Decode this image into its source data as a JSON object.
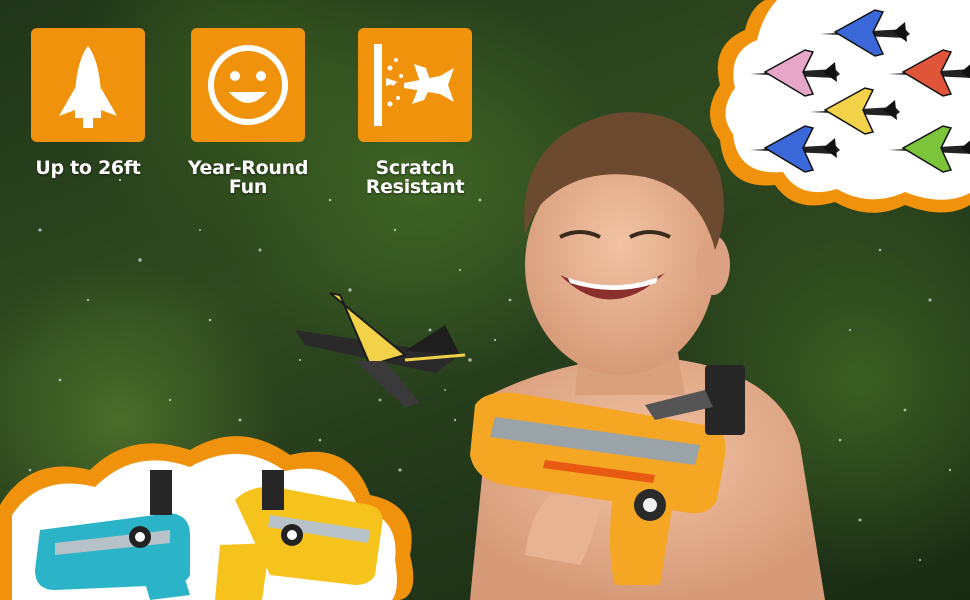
{
  "features": [
    {
      "icon": "rocket-icon",
      "label": "Up to 26ft"
    },
    {
      "icon": "smiley-face-icon",
      "label": "Year-Round Fun"
    },
    {
      "icon": "scratch-resistant-plane-icon",
      "label": "Scratch Resistant"
    }
  ],
  "colors": {
    "accent_orange": "#f0920c",
    "icon_white": "#ffffff",
    "foliage_dark": "#22371a"
  },
  "plane_variants": [
    "blue",
    "pink",
    "red",
    "yellow",
    "blue",
    "green"
  ]
}
